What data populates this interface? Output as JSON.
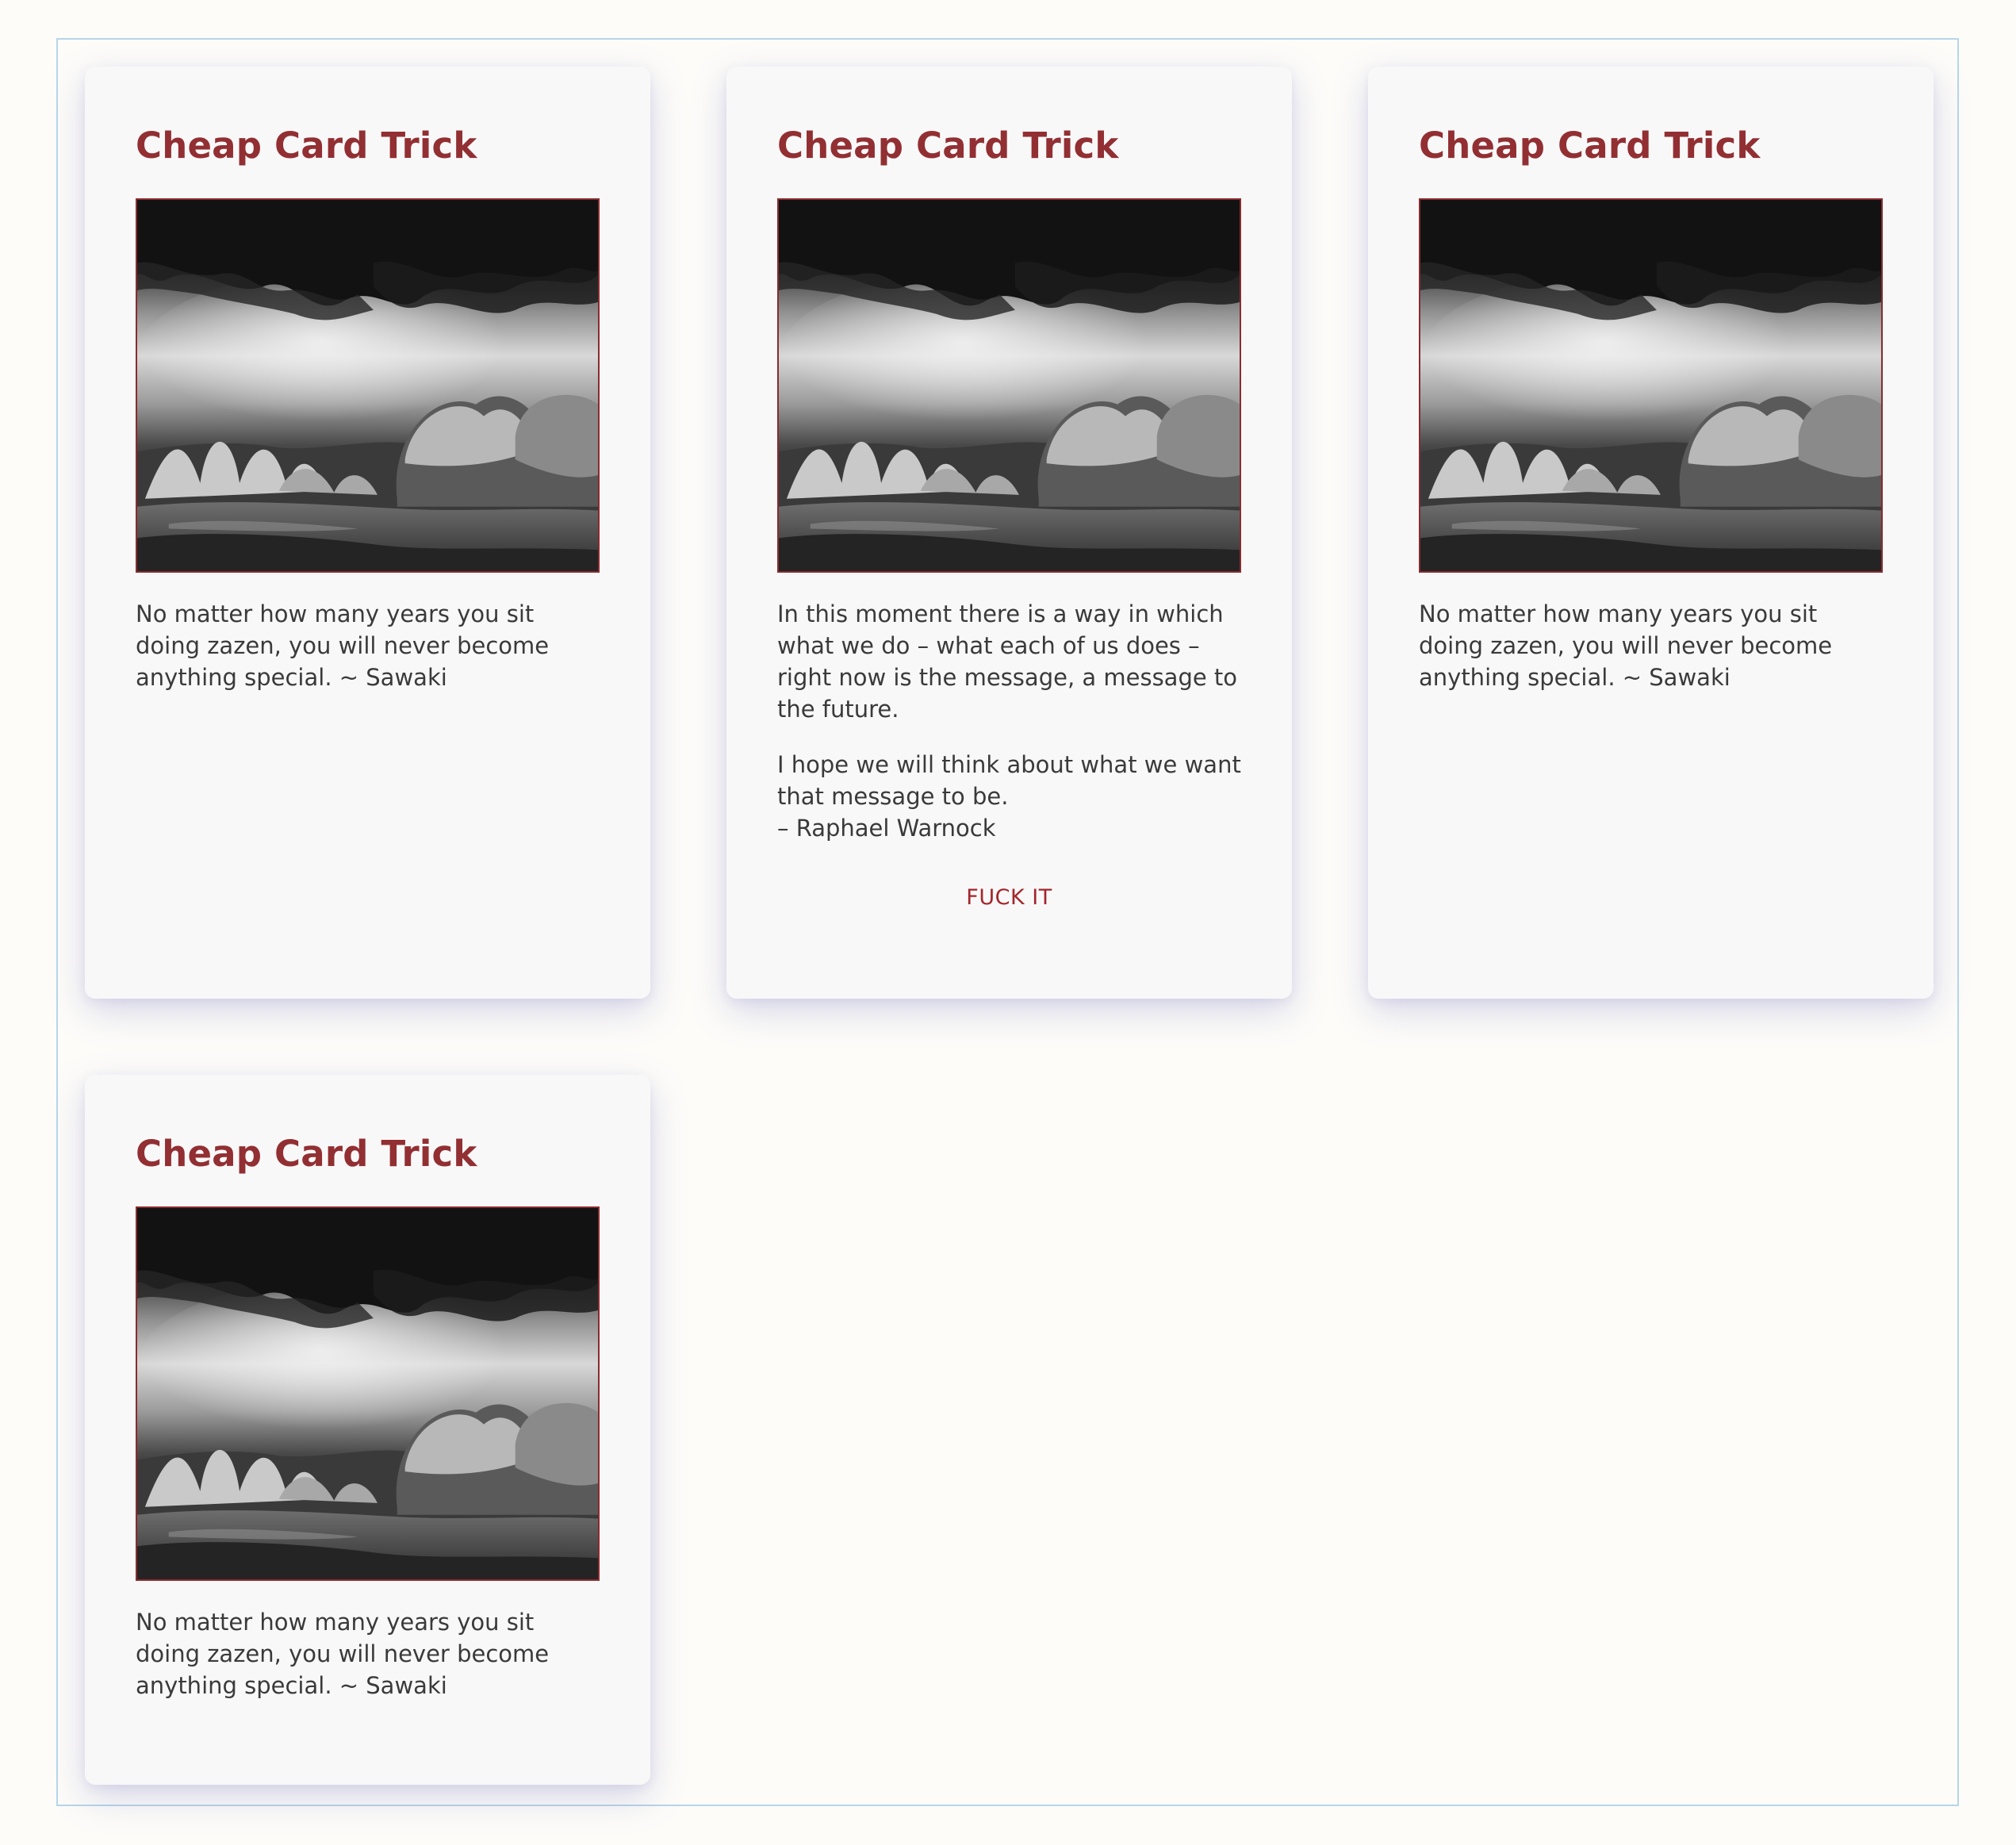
{
  "cards": [
    {
      "title": "Cheap Card Trick",
      "image_alt": "black-and-white landscape photo of storm clouds over trees and a field",
      "paragraphs": [
        "No matter how many years you sit doing zazen, you will never become anything special. ~ Sawaki"
      ]
    },
    {
      "title": "Cheap Card Trick",
      "image_alt": "black-and-white landscape photo of storm clouds over trees and a field",
      "paragraphs": [
        "In this moment there is a way in which what we do – what each of us does – right now is the message, a message to the future.",
        "I hope we will think about what we want that message to be.",
        "– Raphael Warnock"
      ],
      "link_label": "FUCK IT"
    },
    {
      "title": "Cheap Card Trick",
      "image_alt": "black-and-white landscape photo of storm clouds over trees and a field",
      "paragraphs": [
        "No matter how many years you sit doing zazen, you will never become anything special. ~ Sawaki"
      ]
    },
    {
      "title": "Cheap Card Trick",
      "image_alt": "black-and-white landscape photo of storm clouds over trees and a field",
      "paragraphs": [
        "No matter how many years you sit doing zazen, you will never become anything special. ~ Sawaki"
      ]
    }
  ],
  "colors": {
    "title": "#922f33",
    "link": "#a3262c",
    "body_text": "#3a3a3a",
    "card_bg": "#f9f8f8",
    "page_bg": "#fdfcf9",
    "frame_border": "#b7d6ea"
  }
}
